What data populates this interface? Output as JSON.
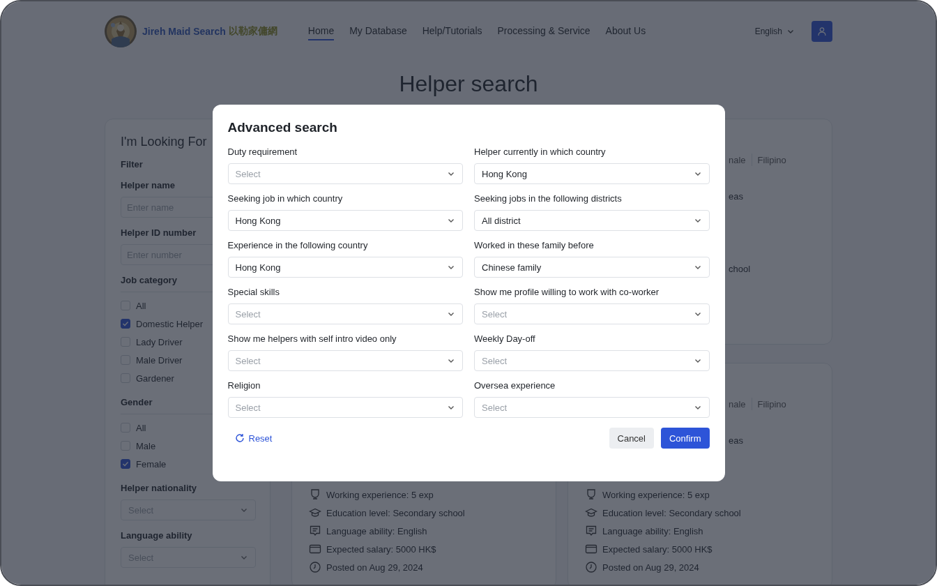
{
  "header": {
    "brand": "Jireh Maid Search",
    "brand_chinese": "以勒家傭網",
    "nav": [
      {
        "label": "Home",
        "selected": true
      },
      {
        "label": "My Database",
        "selected": false
      },
      {
        "label": "Help/Tutorials",
        "selected": false
      },
      {
        "label": "Processing & Service",
        "selected": false
      },
      {
        "label": "About Us",
        "selected": false
      }
    ],
    "language": "English"
  },
  "page_title": "Helper search",
  "sidebar": {
    "title": "I'm Looking For",
    "filter_label": "Filter",
    "sections": [
      {
        "kind": "text_input",
        "label": "Helper name",
        "placeholder": "Enter name"
      },
      {
        "kind": "text_input",
        "label": "Helper ID number",
        "placeholder": "Enter number"
      },
      {
        "kind": "checkbox_group",
        "label": "Job category",
        "options": [
          {
            "label": "All",
            "checked": false
          },
          {
            "label": "Domestic Helper",
            "checked": true
          },
          {
            "label": "Lady Driver",
            "checked": false
          },
          {
            "label": "Male Driver",
            "checked": false
          },
          {
            "label": "Gardener",
            "checked": false
          }
        ]
      },
      {
        "kind": "checkbox_group",
        "label": "Gender",
        "options": [
          {
            "label": "All",
            "checked": false
          },
          {
            "label": "Male",
            "checked": false
          },
          {
            "label": "Female",
            "checked": true
          }
        ]
      },
      {
        "kind": "select",
        "label": "Helper nationality",
        "placeholder": "Select"
      },
      {
        "kind": "select",
        "label": "Language ability",
        "placeholder": "Select"
      }
    ]
  },
  "cards": [
    {
      "tags": [
        "nale",
        "Filipino"
      ],
      "location": "eas",
      "rows": [
        {
          "kind": "education",
          "text": "chool",
          "clipped": true
        }
      ]
    },
    {
      "rows": [
        {
          "kind": "experience",
          "text": "Working experience: 5 exp",
          "clipped": false
        },
        {
          "kind": "education",
          "text": "Education level: Secondary school",
          "clipped": false
        },
        {
          "kind": "language",
          "text": "Language ability: English",
          "clipped": false
        },
        {
          "kind": "salary",
          "text": "Expected salary: 5000 HK$",
          "clipped": false
        },
        {
          "kind": "posted",
          "text": "Posted on Aug 29, 2024",
          "clipped": false
        }
      ]
    },
    {
      "tags": [
        "nale",
        "Filipino"
      ],
      "location": "eas",
      "rows": [
        {
          "kind": "experience",
          "text": "Working experience: 5 exp",
          "clipped": false
        },
        {
          "kind": "education",
          "text": "Education level: Secondary school",
          "clipped": false
        },
        {
          "kind": "language",
          "text": "Language ability: English",
          "clipped": false
        },
        {
          "kind": "salary",
          "text": "Expected salary: 5000 HK$",
          "clipped": false
        },
        {
          "kind": "posted",
          "text": "Posted on Aug 29, 2024",
          "clipped": false
        }
      ]
    }
  ],
  "dialog": {
    "title": "Advanced search",
    "fields": [
      {
        "label": "Duty requirement",
        "placeholder": "Select"
      },
      {
        "label": "Helper currently in which country",
        "value": "Hong Kong"
      },
      {
        "label": "Seeking job in which country",
        "value": "Hong Kong"
      },
      {
        "label": "Seeking jobs in the following districts",
        "value": "All district"
      },
      {
        "label": "Experience in the following country",
        "value": "Hong Kong"
      },
      {
        "label": "Worked in these family before",
        "value": "Chinese family"
      },
      {
        "label": "Special skills",
        "placeholder": "Select"
      },
      {
        "label": "Show me profile willing to work with co-worker",
        "placeholder": "Select"
      },
      {
        "label": "Show me helpers with self intro video only",
        "placeholder": "Select"
      },
      {
        "label": "Weekly Day-off",
        "placeholder": "Select"
      },
      {
        "label": "Religion",
        "placeholder": "Select"
      },
      {
        "label": "Oversea experience",
        "placeholder": "Select"
      }
    ],
    "reset": "Reset",
    "cancel": "Cancel",
    "confirm": "Confirm"
  }
}
